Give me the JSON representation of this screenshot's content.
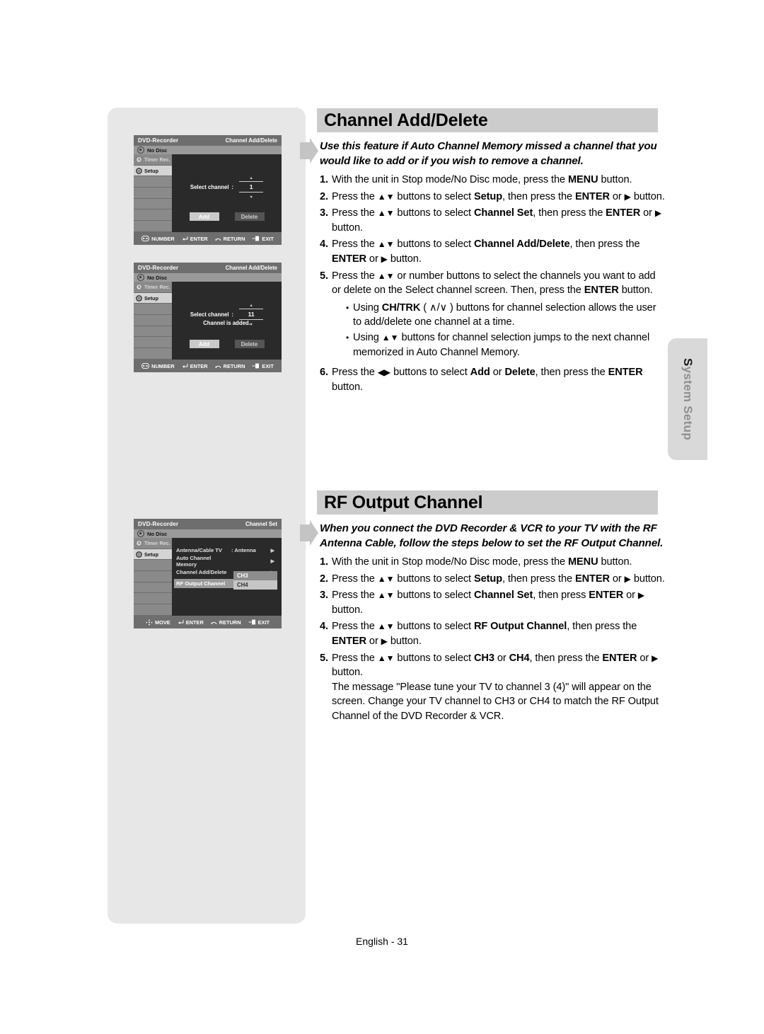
{
  "page": {
    "footer": "English - 31",
    "side_tab": {
      "cap": "S",
      "rest": "ystem Setup"
    }
  },
  "sections": [
    {
      "id": "channel-add-delete",
      "heading": "Channel Add/Delete",
      "intro": "Use this feature if Auto Channel Memory missed a channel that you would like to add or if you wish to remove a channel.",
      "steps": [
        {
          "num": "1.",
          "html": "With the unit in Stop mode/No Disc mode, press the <b>MENU</b> button."
        },
        {
          "num": "2.",
          "html": "Press the <span class=\"arr\">▲▼</span> buttons to select <b>Setup</b>, then press the <b>ENTER</b> or <span class=\"arr\">▶</span> button."
        },
        {
          "num": "3.",
          "html": "Press the <span class=\"arr\">▲▼</span> buttons to select <b>Channel Set</b>, then press the <b>ENTER</b> or <span class=\"arr\">▶</span> button."
        },
        {
          "num": "4.",
          "html": "Press the <span class=\"arr\">▲▼</span> buttons to select <b>Channel Add/Delete</b>, then press the <b>ENTER</b> or <span class=\"arr\">▶</span> button."
        },
        {
          "num": "5.",
          "html": "Press the <span class=\"arr\">▲▼</span> or number buttons to select the channels you want to add or delete on the Select channel screen. Then, press the <b>ENTER</b> button.",
          "bullets": [
            "Using <b>CH/TRK</b> ( ∧/∨ ) buttons for channel selection allows the user to add/delete one channel at a time.",
            "Using <span class=\"arr\">▲▼</span> buttons for channel selection jumps to the next channel memorized in Auto Channel Memory."
          ]
        },
        {
          "num": "6.",
          "html": "Press the <span class=\"arr\">◀▶</span> buttons to select <b>Add</b> or <b>Delete</b>, then press the <b>ENTER</b> button."
        }
      ]
    },
    {
      "id": "rf-output-channel",
      "heading": "RF Output Channel",
      "intro": "When you connect the DVD Recorder & VCR to your TV with the RF Antenna Cable, follow the steps below to set the RF Output Channel.",
      "steps": [
        {
          "num": "1.",
          "html": "With the unit in Stop mode/No Disc mode, press the <b>MENU</b> button."
        },
        {
          "num": "2.",
          "html": "Press the <span class=\"arr\">▲▼</span> buttons to select <b>Setup</b>, then press the <b>ENTER</b> or <span class=\"arr\">▶</span> button."
        },
        {
          "num": "3.",
          "html": "Press the <span class=\"arr\">▲▼</span> buttons to select <b>Channel Set</b>, then press <b>ENTER</b> or <span class=\"arr\">▶</span> button."
        },
        {
          "num": "4.",
          "html": "Press the <span class=\"arr\">▲▼</span> buttons to select <b>RF Output Channel</b>, then press the <b>ENTER</b> or <span class=\"arr\">▶</span> button."
        },
        {
          "num": "5.",
          "html": "Press the <span class=\"arr\">▲▼</span> buttons to select <b>CH3</b> or <b>CH4</b>, then press the <b>ENTER</b> or <span class=\"arr\">▶</span> button.<br>The message \"Please tune your TV to channel 3 (4)\" will appear on the screen. Change your TV channel to CH3 or CH4 to match the RF Output Channel of the DVD Recorder &amp; VCR."
        }
      ]
    }
  ],
  "osd_screens": [
    {
      "id": "osd-channel-add",
      "brand": "DVD-Recorder",
      "screen_title": "Channel Add/Delete",
      "status": "No Disc",
      "side_items": [
        {
          "label": "Timer Rec.",
          "icon": "clock-icon",
          "selected": false
        },
        {
          "label": "Setup",
          "icon": "gear-icon",
          "selected": true
        }
      ],
      "select_channel_label": "Select channel",
      "colon": ":",
      "channel_value": "1",
      "message": "",
      "buttons": {
        "add": "Add",
        "delete": "Delete"
      },
      "footer": [
        {
          "icon": "number-keys-icon",
          "label": "NUMBER"
        },
        {
          "icon": "enter-icon",
          "label": "ENTER"
        },
        {
          "icon": "return-icon",
          "label": "RETURN"
        },
        {
          "icon": "exit-icon",
          "label": "EXIT"
        }
      ]
    },
    {
      "id": "osd-channel-added",
      "brand": "DVD-Recorder",
      "screen_title": "Channel Add/Delete",
      "status": "No Disc",
      "side_items": [
        {
          "label": "Timer Rec.",
          "icon": "clock-icon",
          "selected": false
        },
        {
          "label": "Setup",
          "icon": "gear-icon",
          "selected": true
        }
      ],
      "select_channel_label": "Select channel",
      "colon": ":",
      "channel_value": "11",
      "message": "Channel is added.",
      "buttons": {
        "add": "Add",
        "delete": "Delete"
      },
      "footer": [
        {
          "icon": "number-keys-icon",
          "label": "NUMBER"
        },
        {
          "icon": "enter-icon",
          "label": "ENTER"
        },
        {
          "icon": "return-icon",
          "label": "RETURN"
        },
        {
          "icon": "exit-icon",
          "label": "EXIT"
        }
      ]
    },
    {
      "id": "osd-channel-set",
      "brand": "DVD-Recorder",
      "screen_title": "Channel Set",
      "status": "No Disc",
      "side_items": [
        {
          "label": "Timer Rec.",
          "icon": "clock-icon",
          "selected": false
        },
        {
          "label": "Setup",
          "icon": "gear-icon",
          "selected": true
        }
      ],
      "menu_rows": [
        {
          "label": "Antenna/Cable TV",
          "value": ": Antenna",
          "selected": false
        },
        {
          "label": "Auto Channel Memory",
          "value": "",
          "selected": false
        },
        {
          "label": "Channel Add/Delete",
          "value": "",
          "selected": false
        },
        {
          "label": "RF Output Channel",
          "value": "",
          "selected": true
        }
      ],
      "submenu": [
        {
          "label": "CH3",
          "highlighted": true
        },
        {
          "label": "CH4",
          "highlighted": false
        }
      ],
      "footer": [
        {
          "icon": "move-pad-icon",
          "label": "MOVE"
        },
        {
          "icon": "enter-icon",
          "label": "ENTER"
        },
        {
          "icon": "return-icon",
          "label": "RETURN"
        },
        {
          "icon": "exit-icon",
          "label": "EXIT"
        }
      ]
    }
  ],
  "colors": {
    "heading_bar": "#cccccc",
    "left_panel": "#e7e7e7",
    "side_tab": "#d9d9d9",
    "osd_dark": "#2a2a2a",
    "osd_chrome": "#6e6e6e"
  }
}
